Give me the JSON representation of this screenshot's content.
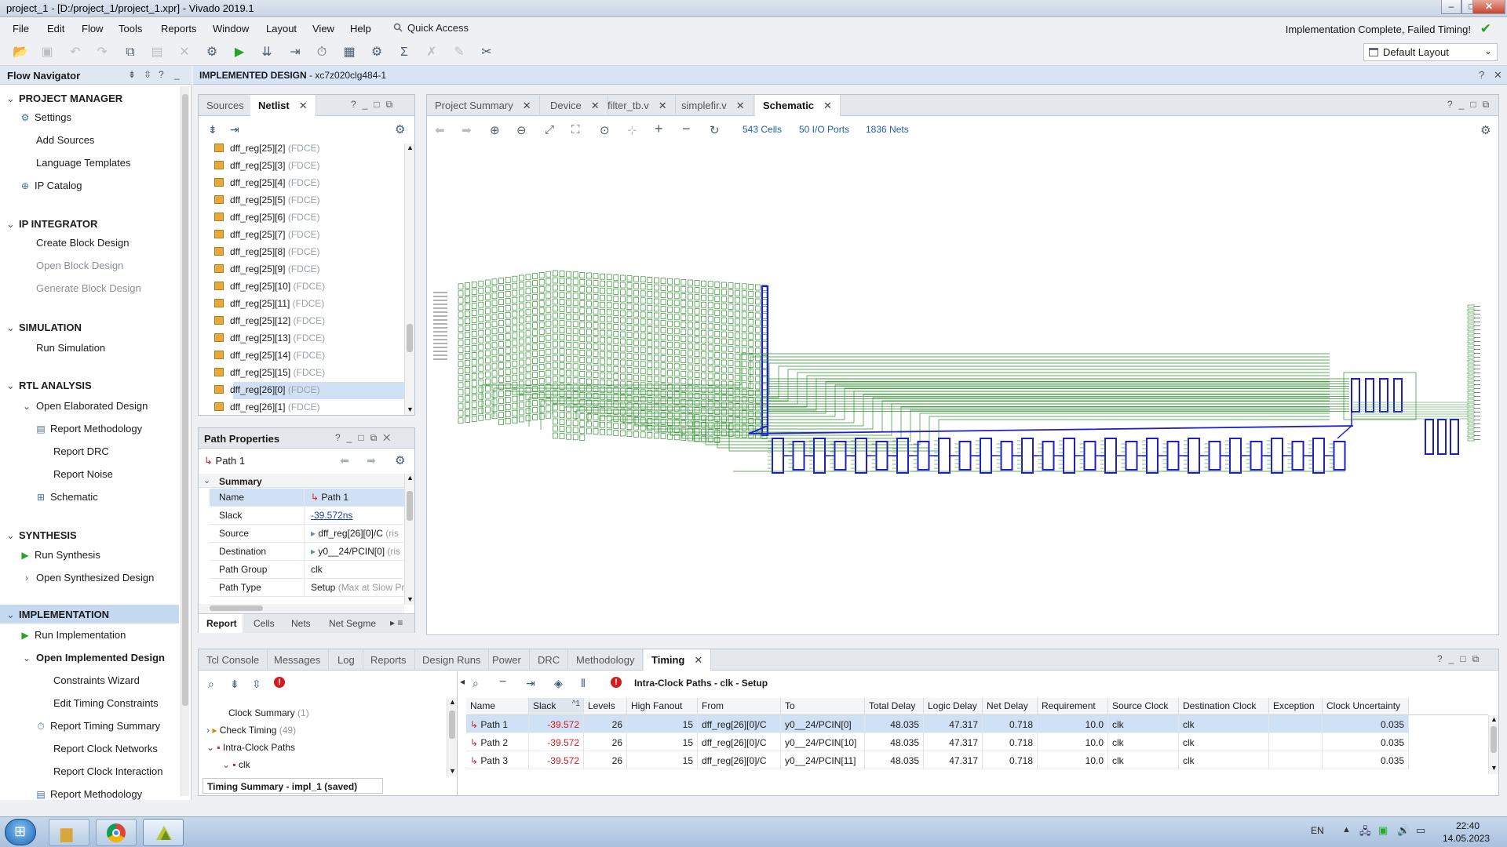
{
  "window": {
    "title": "project_1 - [D:/project_1/project_1.xpr] - Vivado 2019.1"
  },
  "menu": [
    "File",
    "Edit",
    "Flow",
    "Tools",
    "Reports",
    "Window",
    "Layout",
    "View",
    "Help"
  ],
  "quick_access": "Quick Access",
  "status_message": "Implementation Complete, Failed Timing!",
  "layout_select": "Default Layout",
  "flow_navigator": {
    "title": "Flow Navigator",
    "project_manager": {
      "title": "PROJECT MANAGER",
      "items": [
        "Settings",
        "Add Sources",
        "Language Templates",
        "IP Catalog"
      ]
    },
    "ip_integrator": {
      "title": "IP INTEGRATOR",
      "items": [
        "Create Block Design",
        "Open Block Design",
        "Generate Block Design"
      ]
    },
    "simulation": {
      "title": "SIMULATION",
      "items": [
        "Run Simulation"
      ]
    },
    "rtl_analysis": {
      "title": "RTL ANALYSIS",
      "open": "Open Elaborated Design",
      "items": [
        "Report Methodology",
        "Report DRC",
        "Report Noise",
        "Schematic"
      ]
    },
    "synthesis": {
      "title": "SYNTHESIS",
      "items": [
        "Run Synthesis",
        "Open Synthesized Design"
      ]
    },
    "implementation": {
      "title": "IMPLEMENTATION",
      "run": "Run Implementation",
      "open": "Open Implemented Design",
      "items": [
        "Constraints Wizard",
        "Edit Timing Constraints",
        "Report Timing Summary",
        "Report Clock Networks",
        "Report Clock Interaction",
        "Report Methodology"
      ]
    }
  },
  "impl_header": {
    "label": "IMPLEMENTED DESIGN",
    "part": " - xc7z020clg484-1"
  },
  "netlist": {
    "tabs": [
      "Sources",
      "Netlist"
    ],
    "rows": [
      {
        "name": "dff_reg[25][2]",
        "type": " (FDCE)"
      },
      {
        "name": "dff_reg[25][3]",
        "type": " (FDCE)"
      },
      {
        "name": "dff_reg[25][4]",
        "type": " (FDCE)"
      },
      {
        "name": "dff_reg[25][5]",
        "type": " (FDCE)"
      },
      {
        "name": "dff_reg[25][6]",
        "type": " (FDCE)"
      },
      {
        "name": "dff_reg[25][7]",
        "type": " (FDCE)"
      },
      {
        "name": "dff_reg[25][8]",
        "type": " (FDCE)"
      },
      {
        "name": "dff_reg[25][9]",
        "type": " (FDCE)"
      },
      {
        "name": "dff_reg[25][10]",
        "type": " (FDCE)"
      },
      {
        "name": "dff_reg[25][11]",
        "type": " (FDCE)"
      },
      {
        "name": "dff_reg[25][12]",
        "type": " (FDCE)"
      },
      {
        "name": "dff_reg[25][13]",
        "type": " (FDCE)"
      },
      {
        "name": "dff_reg[25][14]",
        "type": " (FDCE)"
      },
      {
        "name": "dff_reg[25][15]",
        "type": " (FDCE)"
      },
      {
        "name": "dff_reg[26][0]",
        "type": " (FDCE)"
      },
      {
        "name": "dff_reg[26][1]",
        "type": " (FDCE)"
      }
    ]
  },
  "path_props": {
    "title": "Path Properties",
    "path": "Path 1",
    "section": "Summary",
    "rows": [
      {
        "label": "Name",
        "value": "Path 1",
        "extra": ""
      },
      {
        "label": "Slack",
        "value": "-39.572ns",
        "extra": ""
      },
      {
        "label": "Source",
        "value": "dff_reg[26][0]/C",
        "extra": " (ris"
      },
      {
        "label": "Destination",
        "value": "y0__24/PCIN[0]",
        "extra": " (ris"
      },
      {
        "label": "Path Group",
        "value": "clk",
        "extra": ""
      },
      {
        "label": "Path Type",
        "value": "Setup",
        "extra": " (Max at Slow Pro"
      }
    ],
    "tabs": [
      "Report",
      "Cells",
      "Nets",
      "Net Segme"
    ]
  },
  "editor_tabs": [
    "Project Summary",
    "Device",
    "filter_tb.v",
    "simplefir.v",
    "Schematic"
  ],
  "schematic": {
    "cells": "543 Cells",
    "ports": "50 I/O Ports",
    "nets": "1836 Nets"
  },
  "console_tabs": [
    "Tcl Console",
    "Messages",
    "Log",
    "Reports",
    "Design Runs",
    "Power",
    "DRC",
    "Methodology",
    "Timing"
  ],
  "timing": {
    "tree": [
      {
        "label": "Clock Summary",
        "count": " (1)"
      },
      {
        "label": "Check Timing",
        "count": " (49)"
      },
      {
        "label": "Intra-Clock Paths",
        "count": ""
      },
      {
        "label": "clk",
        "count": ""
      }
    ],
    "status": "Timing Summary - impl_1 (saved)",
    "title": "Intra-Clock Paths - clk - Setup",
    "columns": [
      "Name",
      "Slack",
      "Levels",
      "High Fanout",
      "From",
      "To",
      "Total Delay",
      "Logic Delay",
      "Net Delay",
      "Requirement",
      "Source Clock",
      "Destination Clock",
      "Exception",
      "Clock Uncertainty"
    ],
    "sort_indicator": "^1",
    "rows": [
      {
        "name": "Path 1",
        "slack": "-39.572",
        "levels": "26",
        "fanout": "15",
        "from": "dff_reg[26][0]/C",
        "to": "y0__24/PCIN[0]",
        "total": "48.035",
        "logic": "47.317",
        "net": "0.718",
        "req": "10.0",
        "src": "clk",
        "dst": "clk",
        "exc": "",
        "unc": "0.035"
      },
      {
        "name": "Path 2",
        "slack": "-39.572",
        "levels": "26",
        "fanout": "15",
        "from": "dff_reg[26][0]/C",
        "to": "y0__24/PCIN[10]",
        "total": "48.035",
        "logic": "47.317",
        "net": "0.718",
        "req": "10.0",
        "src": "clk",
        "dst": "clk",
        "exc": "",
        "unc": "0.035"
      },
      {
        "name": "Path 3",
        "slack": "-39.572",
        "levels": "26",
        "fanout": "15",
        "from": "dff_reg[26][0]/C",
        "to": "y0__24/PCIN[11]",
        "total": "48.035",
        "logic": "47.317",
        "net": "0.718",
        "req": "10.0",
        "src": "clk",
        "dst": "clk",
        "exc": "",
        "unc": "0.035"
      }
    ]
  },
  "taskbar": {
    "lang": "EN",
    "time": "22:40",
    "date": "14.05.2023"
  },
  "colors": {
    "accent": "#c5d9f1",
    "schematic_green": "#2f8f2f",
    "schematic_blue": "#1f1fc8",
    "fail_red": "#d41a1a"
  }
}
